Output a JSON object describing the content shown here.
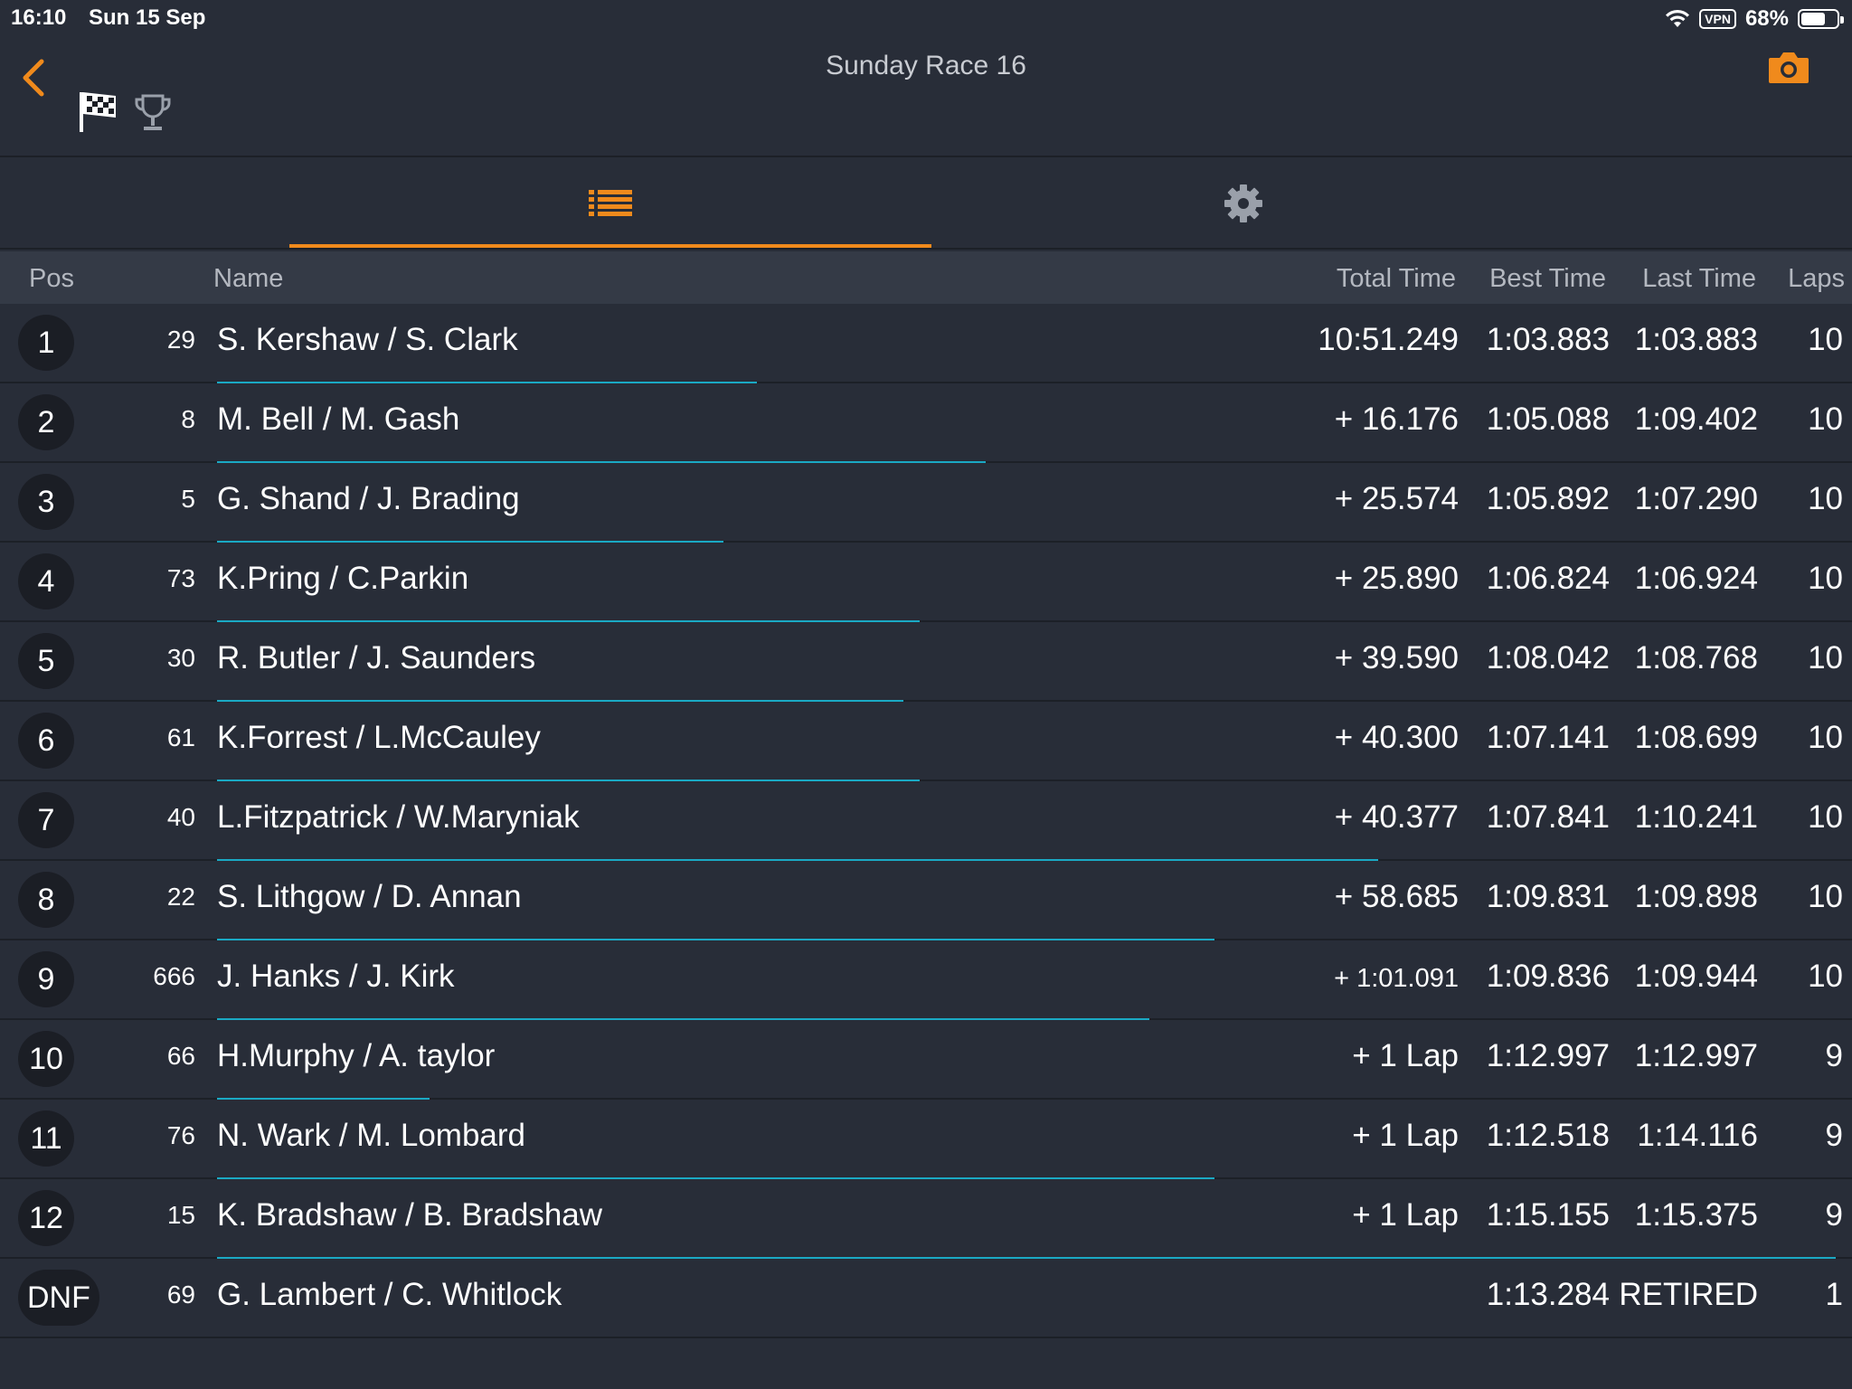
{
  "status_bar": {
    "time": "16:10",
    "date": "Sun 15 Sep",
    "vpn": "VPN",
    "battery": "68%",
    "battery_level": 0.68
  },
  "nav": {
    "title": "Sunday Race 16",
    "accent_color": "#f08a1c"
  },
  "tabs": {
    "active": "results-list",
    "items": [
      "list-icon",
      "gear-icon"
    ]
  },
  "table": {
    "headers": {
      "pos": "Pos",
      "name": "Name",
      "total": "Total Time",
      "best": "Best Time",
      "last": "Last Time",
      "laps": "Laps"
    },
    "rows": [
      {
        "pos": "1",
        "car": "29",
        "name": "S. Kershaw / S. Clark",
        "total": "10:51.249",
        "best": "1:03.883",
        "last": "1:03.883",
        "laps": "10",
        "progress": 0.33
      },
      {
        "pos": "2",
        "car": "8",
        "name": "M. Bell / M. Gash",
        "total": "+ 16.176",
        "best": "1:05.088",
        "last": "1:09.402",
        "laps": "10",
        "progress": 0.47
      },
      {
        "pos": "3",
        "car": "5",
        "name": "G. Shand / J. Brading",
        "total": "+ 25.574",
        "best": "1:05.892",
        "last": "1:07.290",
        "laps": "10",
        "progress": 0.31
      },
      {
        "pos": "4",
        "car": "73",
        "name": "K.Pring / C.Parkin",
        "total": "+ 25.890",
        "best": "1:06.824",
        "last": "1:06.924",
        "laps": "10",
        "progress": 0.43
      },
      {
        "pos": "5",
        "car": "30",
        "name": "R. Butler /  J. Saunders",
        "total": "+ 39.590",
        "best": "1:08.042",
        "last": "1:08.768",
        "laps": "10",
        "progress": 0.42
      },
      {
        "pos": "6",
        "car": "61",
        "name": "K.Forrest / L.McCauley",
        "total": "+ 40.300",
        "best": "1:07.141",
        "last": "1:08.699",
        "laps": "10",
        "progress": 0.43
      },
      {
        "pos": "7",
        "car": "40",
        "name": "L.Fitzpatrick / W.Maryniak",
        "total": "+ 40.377",
        "best": "1:07.841",
        "last": "1:10.241",
        "laps": "10",
        "progress": 0.71
      },
      {
        "pos": "8",
        "car": "22",
        "name": "S. Lithgow /  D. Annan",
        "total": "+ 58.685",
        "best": "1:09.831",
        "last": "1:09.898",
        "laps": "10",
        "progress": 0.61
      },
      {
        "pos": "9",
        "car": "666",
        "name": "J. Hanks /  J. Kirk",
        "total": "+ 1:01.091",
        "best": "1:09.836",
        "last": "1:09.944",
        "laps": "10",
        "progress": 0.57,
        "total_small": true
      },
      {
        "pos": "10",
        "car": "66",
        "name": "H.Murphy / A. taylor",
        "total": "+ 1 Lap",
        "best": "1:12.997",
        "last": "1:12.997",
        "laps": "9",
        "progress": 0.13
      },
      {
        "pos": "11",
        "car": "76",
        "name": "N. Wark / M. Lombard",
        "total": "+ 1 Lap",
        "best": "1:12.518",
        "last": "1:14.116",
        "laps": "9",
        "progress": 0.61
      },
      {
        "pos": "12",
        "car": "15",
        "name": "K. Bradshaw / B. Bradshaw",
        "total": "+ 1 Lap",
        "best": "1:15.155",
        "last": "1:15.375",
        "laps": "9",
        "progress": 0.99
      },
      {
        "pos": "DNF",
        "car": "69",
        "name": "G. Lambert / C. Whitlock",
        "total": "",
        "best": "1:13.284",
        "last": "RETIRED",
        "laps": "1",
        "progress": 0.0
      }
    ]
  }
}
